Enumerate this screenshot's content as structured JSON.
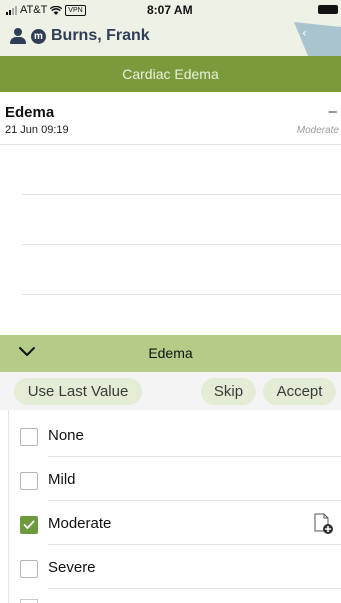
{
  "status_bar": {
    "carrier": "AT&T",
    "vpn": "VPN",
    "time": "8:07 AM"
  },
  "patient": {
    "badge": "m",
    "name": "Burns, Frank"
  },
  "back_tab": {
    "glyph": "‹"
  },
  "title": "Cardiac Edema",
  "record": {
    "name": "Edema",
    "date": "21 Jun 09:19",
    "trend": "–",
    "value": "Moderate"
  },
  "panel": {
    "label": "Edema",
    "actions": {
      "use_last": "Use Last Value",
      "skip": "Skip",
      "accept": "Accept"
    },
    "options": [
      {
        "label": "None",
        "checked": false
      },
      {
        "label": "Mild",
        "checked": false
      },
      {
        "label": "Moderate",
        "checked": true
      },
      {
        "label": "Severe",
        "checked": false
      }
    ]
  },
  "colors": {
    "header_bg": "#eef1e6",
    "title_bar": "#7b9a3b",
    "panel_head": "#b4cc88",
    "pill": "#e3ecd4",
    "checkbox_checked": "#6e9a3e",
    "patient_text": "#2f3e56",
    "back_tab": "#a9c4cf"
  },
  "icons": [
    "signal-icon",
    "wifi-icon",
    "battery-icon",
    "person-icon",
    "chevron-down-icon",
    "chevron-left-icon",
    "check-icon",
    "document-add-icon"
  ]
}
